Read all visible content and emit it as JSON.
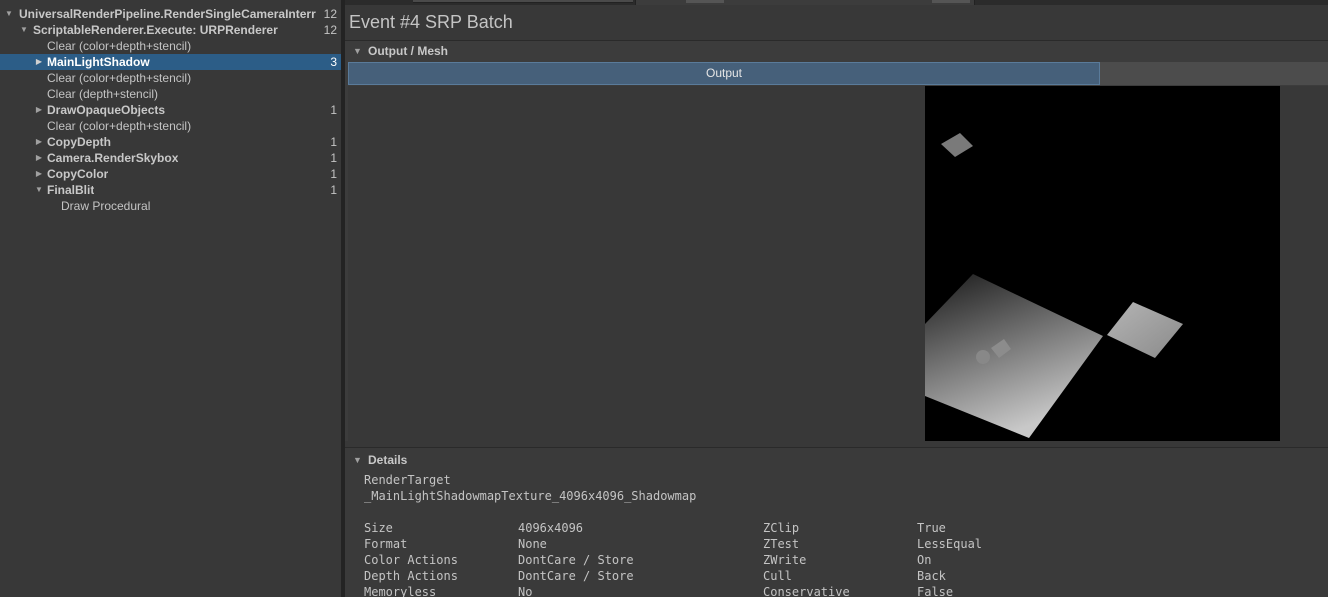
{
  "hierarchy": {
    "rows": [
      {
        "label": "UniversalRenderPipeline.RenderSingleCameraInterr",
        "count": "12",
        "expanded": true
      },
      {
        "label": "ScriptableRenderer.Execute: URPRenderer",
        "count": "12",
        "expanded": true
      },
      {
        "label": "Clear (color+depth+stencil)",
        "count": ""
      },
      {
        "label": "MainLightShadow",
        "count": "3",
        "selected": true
      },
      {
        "label": "Clear (color+depth+stencil)",
        "count": ""
      },
      {
        "label": "Clear (depth+stencil)",
        "count": ""
      },
      {
        "label": "DrawOpaqueObjects",
        "count": "1"
      },
      {
        "label": "Clear (color+depth+stencil)",
        "count": ""
      },
      {
        "label": "CopyDepth",
        "count": "1"
      },
      {
        "label": "Camera.RenderSkybox",
        "count": "1"
      },
      {
        "label": "CopyColor",
        "count": "1"
      },
      {
        "label": "FinalBlit",
        "count": "1",
        "expanded": true
      },
      {
        "label": "Draw Procedural",
        "count": ""
      }
    ]
  },
  "event": {
    "title": "Event #4 SRP Batch"
  },
  "output_section": {
    "title": "Output / Mesh",
    "tab_label": "Output"
  },
  "details": {
    "title": "Details",
    "render_target_label": "RenderTarget",
    "render_target_value": "_MainLightShadowmapTexture_4096x4096_Shadowmap",
    "left_props": [
      {
        "name": "Size",
        "value": "4096x4096"
      },
      {
        "name": "Format",
        "value": "None"
      },
      {
        "name": "Color Actions",
        "value": "DontCare / Store"
      },
      {
        "name": "Depth Actions",
        "value": "DontCare / Store"
      },
      {
        "name": "Memoryless",
        "value": "No"
      }
    ],
    "right_props": [
      {
        "name": "ZClip",
        "value": "True"
      },
      {
        "name": "ZTest",
        "value": "LessEqual"
      },
      {
        "name": "ZWrite",
        "value": "On"
      },
      {
        "name": "Cull",
        "value": "Back"
      },
      {
        "name": "Conservative",
        "value": "False"
      }
    ]
  },
  "colors": {
    "selection": "#2c5d87",
    "active_tab": "#46607a",
    "panel": "#383838"
  },
  "icons": {
    "expanded": "triangle-down-icon",
    "collapsed": "triangle-right-icon"
  }
}
